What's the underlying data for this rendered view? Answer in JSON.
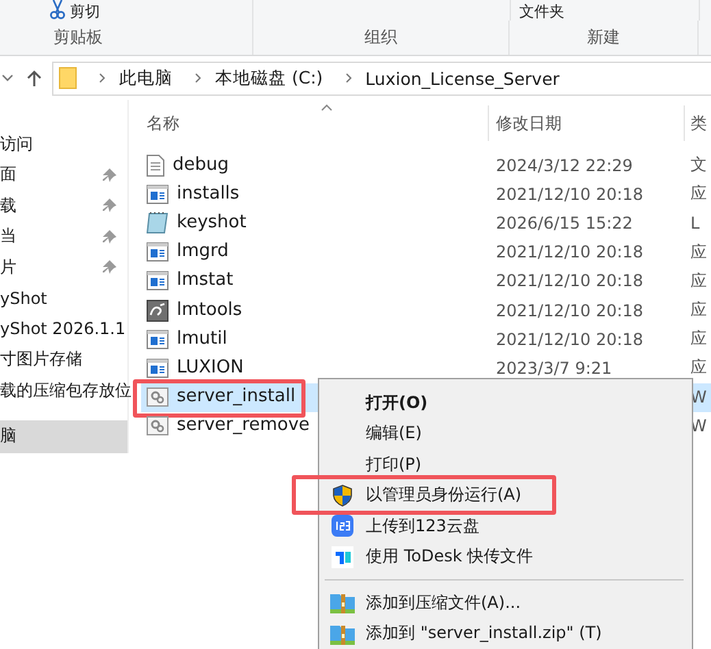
{
  "ribbon": {
    "clip_item": "剪切",
    "folder_item": "文件夹",
    "groups": [
      "剪贴板",
      "组织",
      "新建"
    ]
  },
  "address": {
    "crumbs": [
      "此电脑",
      "本地磁盘 (C:)",
      "Luxion_License_Server"
    ]
  },
  "sidebar": {
    "items": [
      {
        "label": "访问",
        "pinned": false,
        "selected": false
      },
      {
        "label": "面",
        "pinned": true,
        "selected": false
      },
      {
        "label": "载",
        "pinned": true,
        "selected": false
      },
      {
        "label": "当",
        "pinned": true,
        "selected": false
      },
      {
        "label": "片",
        "pinned": true,
        "selected": false
      },
      {
        "label": "yShot",
        "pinned": false,
        "selected": false
      },
      {
        "label": "yShot 2026.1.1",
        "pinned": false,
        "selected": false
      },
      {
        "label": "寸图片存储",
        "pinned": false,
        "selected": false
      },
      {
        "label": "载的压缩包存放位",
        "pinned": false,
        "selected": false
      },
      {
        "label": "脑",
        "pinned": false,
        "selected": true
      }
    ]
  },
  "files": {
    "columns": [
      "名称",
      "修改日期",
      "类"
    ],
    "rows": [
      {
        "name": "debug",
        "kind": "text",
        "modified": "2024/3/12 22:29",
        "type": "文",
        "selected": false,
        "highlighted": false
      },
      {
        "name": "installs",
        "kind": "app",
        "modified": "2021/12/10 20:18",
        "type": "应",
        "selected": false,
        "highlighted": false
      },
      {
        "name": "keyshot",
        "kind": "notepad",
        "modified": "2026/6/15 15:22",
        "type": "L",
        "selected": false,
        "highlighted": false
      },
      {
        "name": "lmgrd",
        "kind": "app",
        "modified": "2021/12/10 20:18",
        "type": "应",
        "selected": false,
        "highlighted": false
      },
      {
        "name": "lmstat",
        "kind": "app",
        "modified": "2021/12/10 20:18",
        "type": "应",
        "selected": false,
        "highlighted": false
      },
      {
        "name": "lmtools",
        "kind": "tool",
        "modified": "2021/12/10 20:18",
        "type": "应",
        "selected": false,
        "highlighted": false
      },
      {
        "name": "lmutil",
        "kind": "app",
        "modified": "2021/12/10 20:18",
        "type": "应",
        "selected": false,
        "highlighted": false
      },
      {
        "name": "LUXION",
        "kind": "app",
        "modified": "2023/3/7 9:21",
        "type": "应",
        "selected": false,
        "highlighted": false
      },
      {
        "name": "server_install",
        "kind": "gear",
        "type": "W",
        "selected": true,
        "highlighted": true
      },
      {
        "name": "server_remove",
        "kind": "gear",
        "type": "W",
        "selected": false,
        "highlighted": false
      }
    ]
  },
  "context_menu": {
    "items": [
      {
        "kind": "plain",
        "label": "打开(O)",
        "default": true,
        "highlighted": false
      },
      {
        "kind": "plain",
        "label": "编辑(E)",
        "default": false,
        "highlighted": false
      },
      {
        "kind": "plain",
        "label": "打印(P)",
        "default": false,
        "highlighted": false
      },
      {
        "kind": "shield",
        "label": "以管理员身份运行(A)",
        "default": false,
        "highlighted": true
      },
      {
        "kind": "cloud",
        "label": "上传到123云盘",
        "default": false,
        "highlighted": false
      },
      {
        "kind": "transfer",
        "label": "使用 ToDesk 快传文件",
        "default": false,
        "highlighted": false
      },
      {
        "kind": "separator"
      },
      {
        "kind": "archive",
        "label": "添加到压缩文件(A)...",
        "default": false,
        "highlighted": false
      },
      {
        "kind": "archive",
        "label": "添加到 \"server_install.zip\" (T)",
        "default": false,
        "highlighted": false
      }
    ]
  }
}
